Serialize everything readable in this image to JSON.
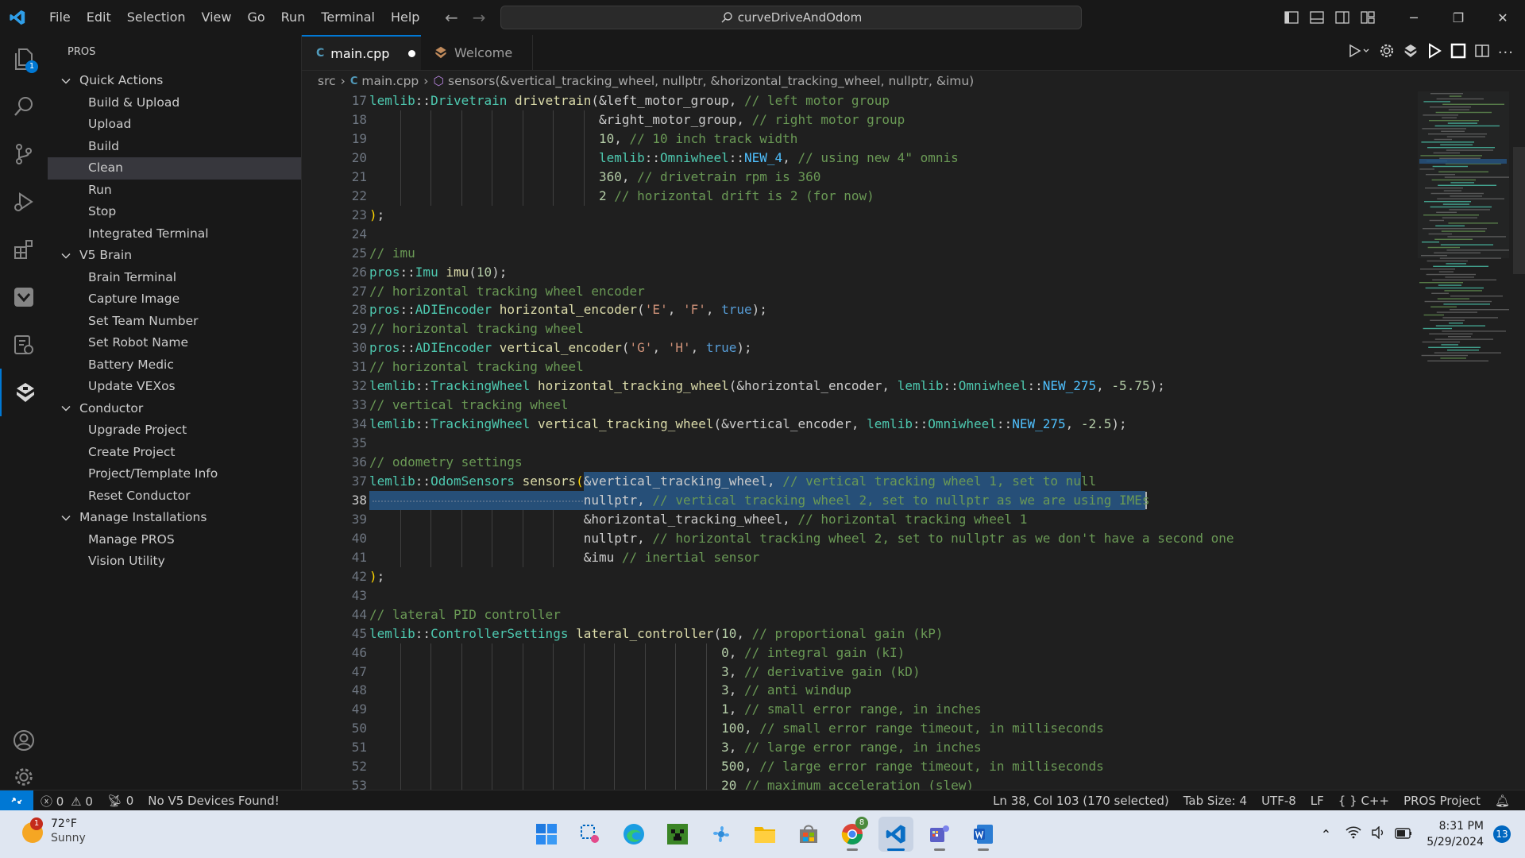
{
  "menu": [
    "File",
    "Edit",
    "Selection",
    "View",
    "Go",
    "Run",
    "Terminal",
    "Help"
  ],
  "command_center": "curveDriveAndOdom",
  "activity_bar": {
    "explorer_badge": "1",
    "items": [
      "files-icon",
      "search-icon",
      "source-control-icon",
      "run-debug-icon",
      "extensions-icon",
      "vex-icon",
      "remote-explorer-icon",
      "pros-icon"
    ],
    "bottom": [
      "accounts-icon",
      "settings-gear-icon"
    ]
  },
  "sidebar": {
    "title": "PROS",
    "groups": [
      {
        "label": "Quick Actions",
        "items": [
          "Build & Upload",
          "Upload",
          "Build",
          "Clean",
          "Run",
          "Stop",
          "Integrated Terminal"
        ]
      },
      {
        "label": "V5 Brain",
        "items": [
          "Brain Terminal",
          "Capture Image",
          "Set Team Number",
          "Set Robot Name",
          "Battery Medic",
          "Update VEXos"
        ]
      },
      {
        "label": "Conductor",
        "items": [
          "Upgrade Project",
          "Create Project",
          "Project/Template Info",
          "Reset Conductor"
        ]
      },
      {
        "label": "Manage Installations",
        "items": [
          "Manage PROS",
          "Vision Utility"
        ]
      }
    ],
    "selected": "Clean"
  },
  "tabs": [
    {
      "label": "main.cpp",
      "dirty": true,
      "active": true
    },
    {
      "label": "Welcome",
      "dirty": false,
      "active": false
    }
  ],
  "breadcrumb": {
    "folder": "src",
    "file": "main.cpp",
    "symbol": "sensors(&vertical_tracking_wheel, nullptr, &horizontal_tracking_wheel, nullptr, &imu)"
  },
  "editor": {
    "current_line": 38,
    "lines": [
      {
        "n": 17,
        "t": [
          [
            "ns",
            "lemlib"
          ],
          [
            "p",
            "::"
          ],
          [
            "ty",
            "Drivetrain"
          ],
          [
            "p",
            " "
          ],
          [
            "fn",
            "drivetrain"
          ],
          [
            "p",
            "("
          ],
          [
            "p",
            "&left_motor_group"
          ],
          [
            "p",
            ", "
          ],
          [
            "c",
            "// left motor group"
          ]
        ]
      },
      {
        "n": 18,
        "t": [
          [
            "p",
            "                              "
          ],
          [
            "p",
            "&right_motor_group"
          ],
          [
            "p",
            ", "
          ],
          [
            "c",
            "// right motor group"
          ]
        ]
      },
      {
        "n": 19,
        "t": [
          [
            "p",
            "                              "
          ],
          [
            "num",
            "10"
          ],
          [
            "p",
            ", "
          ],
          [
            "c",
            "// 10 inch track width"
          ]
        ]
      },
      {
        "n": 20,
        "t": [
          [
            "p",
            "                              "
          ],
          [
            "ns",
            "lemlib"
          ],
          [
            "p",
            "::"
          ],
          [
            "ty",
            "Omniwheel"
          ],
          [
            "p",
            "::"
          ],
          [
            "mac",
            "NEW_4"
          ],
          [
            "p",
            ", "
          ],
          [
            "c",
            "// using new 4\" omnis"
          ]
        ]
      },
      {
        "n": 21,
        "t": [
          [
            "p",
            "                              "
          ],
          [
            "num",
            "360"
          ],
          [
            "p",
            ", "
          ],
          [
            "c",
            "// drivetrain rpm is 360"
          ]
        ]
      },
      {
        "n": 22,
        "t": [
          [
            "p",
            "                              "
          ],
          [
            "num",
            "2"
          ],
          [
            "p",
            " "
          ],
          [
            "c",
            "// horizontal drift is 2 (for now)"
          ]
        ]
      },
      {
        "n": 23,
        "t": [
          [
            "br",
            ")"
          ],
          [
            "p",
            ";"
          ]
        ]
      },
      {
        "n": 24,
        "t": []
      },
      {
        "n": 25,
        "t": [
          [
            "c",
            "// imu"
          ]
        ]
      },
      {
        "n": 26,
        "t": [
          [
            "ns",
            "pros"
          ],
          [
            "p",
            "::"
          ],
          [
            "ty",
            "Imu"
          ],
          [
            "p",
            " "
          ],
          [
            "fn",
            "imu"
          ],
          [
            "p",
            "("
          ],
          [
            "num",
            "10"
          ],
          [
            "p",
            ");"
          ]
        ]
      },
      {
        "n": 27,
        "t": [
          [
            "c",
            "// horizontal tracking wheel encoder"
          ]
        ]
      },
      {
        "n": 28,
        "t": [
          [
            "ns",
            "pros"
          ],
          [
            "p",
            "::"
          ],
          [
            "ty",
            "ADIEncoder"
          ],
          [
            "p",
            " "
          ],
          [
            "fn",
            "horizontal_encoder"
          ],
          [
            "p",
            "("
          ],
          [
            "str",
            "'E'"
          ],
          [
            "p",
            ", "
          ],
          [
            "str",
            "'F'"
          ],
          [
            "p",
            ", "
          ],
          [
            "kw",
            "true"
          ],
          [
            "p",
            ");"
          ]
        ]
      },
      {
        "n": 29,
        "t": [
          [
            "c",
            "// horizontal tracking wheel"
          ]
        ]
      },
      {
        "n": 30,
        "t": [
          [
            "ns",
            "pros"
          ],
          [
            "p",
            "::"
          ],
          [
            "ty",
            "ADIEncoder"
          ],
          [
            "p",
            " "
          ],
          [
            "fn",
            "vertical_encoder"
          ],
          [
            "p",
            "("
          ],
          [
            "str",
            "'G'"
          ],
          [
            "p",
            ", "
          ],
          [
            "str",
            "'H'"
          ],
          [
            "p",
            ", "
          ],
          [
            "kw",
            "true"
          ],
          [
            "p",
            ");"
          ]
        ]
      },
      {
        "n": 31,
        "t": [
          [
            "c",
            "// horizontal tracking wheel"
          ]
        ]
      },
      {
        "n": 32,
        "t": [
          [
            "ns",
            "lemlib"
          ],
          [
            "p",
            "::"
          ],
          [
            "ty",
            "TrackingWheel"
          ],
          [
            "p",
            " "
          ],
          [
            "fn",
            "horizontal_tracking_wheel"
          ],
          [
            "p",
            "(&horizontal_encoder, "
          ],
          [
            "ns",
            "lemlib"
          ],
          [
            "p",
            "::"
          ],
          [
            "ty",
            "Omniwheel"
          ],
          [
            "p",
            "::"
          ],
          [
            "mac",
            "NEW_275"
          ],
          [
            "p",
            ", "
          ],
          [
            "num",
            "-5.75"
          ],
          [
            "p",
            ");"
          ]
        ]
      },
      {
        "n": 33,
        "t": [
          [
            "c",
            "// vertical tracking wheel"
          ]
        ]
      },
      {
        "n": 34,
        "t": [
          [
            "ns",
            "lemlib"
          ],
          [
            "p",
            "::"
          ],
          [
            "ty",
            "TrackingWheel"
          ],
          [
            "p",
            " "
          ],
          [
            "fn",
            "vertical_tracking_wheel"
          ],
          [
            "p",
            "(&vertical_encoder, "
          ],
          [
            "ns",
            "lemlib"
          ],
          [
            "p",
            "::"
          ],
          [
            "ty",
            "Omniwheel"
          ],
          [
            "p",
            "::"
          ],
          [
            "mac",
            "NEW_275"
          ],
          [
            "p",
            ", "
          ],
          [
            "num",
            "-2.5"
          ],
          [
            "p",
            ");"
          ]
        ]
      },
      {
        "n": 35,
        "t": []
      },
      {
        "n": 36,
        "t": [
          [
            "c",
            "// odometry settings"
          ]
        ]
      },
      {
        "n": 37,
        "t": [
          [
            "ns",
            "lemlib"
          ],
          [
            "p",
            "::"
          ],
          [
            "ty",
            "OdomSensors"
          ],
          [
            "p",
            " "
          ],
          [
            "fn",
            "sensors"
          ],
          [
            "br",
            "("
          ],
          [
            "p",
            "&vertical_tracking_wheel"
          ],
          [
            "p",
            ", "
          ],
          [
            "c",
            "// vertical tracking wheel 1, set to null"
          ]
        ]
      },
      {
        "n": 38,
        "t": [
          [
            "p",
            "                            "
          ],
          [
            "p",
            "nullptr"
          ],
          [
            "p",
            ", "
          ],
          [
            "c",
            "// vertical tracking wheel 2, set to nullptr as we are using IMEs"
          ]
        ]
      },
      {
        "n": 39,
        "t": [
          [
            "p",
            "                            "
          ],
          [
            "p",
            "&horizontal_tracking_wheel"
          ],
          [
            "p",
            ", "
          ],
          [
            "c",
            "// horizontal tracking wheel 1"
          ]
        ]
      },
      {
        "n": 40,
        "t": [
          [
            "p",
            "                            "
          ],
          [
            "p",
            "nullptr"
          ],
          [
            "p",
            ", "
          ],
          [
            "c",
            "// horizontal tracking wheel 2, set to nullptr as we don't have a second one"
          ]
        ]
      },
      {
        "n": 41,
        "t": [
          [
            "p",
            "                            "
          ],
          [
            "p",
            "&imu"
          ],
          [
            "p",
            " "
          ],
          [
            "c",
            "// inertial sensor"
          ]
        ]
      },
      {
        "n": 42,
        "t": [
          [
            "br",
            ")"
          ],
          [
            "p",
            ";"
          ]
        ]
      },
      {
        "n": 43,
        "t": []
      },
      {
        "n": 44,
        "t": [
          [
            "c",
            "// lateral PID controller"
          ]
        ]
      },
      {
        "n": 45,
        "t": [
          [
            "ns",
            "lemlib"
          ],
          [
            "p",
            "::"
          ],
          [
            "ty",
            "ControllerSettings"
          ],
          [
            "p",
            " "
          ],
          [
            "fn",
            "lateral_controller"
          ],
          [
            "p",
            "("
          ],
          [
            "num",
            "10"
          ],
          [
            "p",
            ", "
          ],
          [
            "c",
            "// proportional gain (kP)"
          ]
        ]
      },
      {
        "n": 46,
        "t": [
          [
            "p",
            "                                              "
          ],
          [
            "num",
            "0"
          ],
          [
            "p",
            ", "
          ],
          [
            "c",
            "// integral gain (kI)"
          ]
        ]
      },
      {
        "n": 47,
        "t": [
          [
            "p",
            "                                              "
          ],
          [
            "num",
            "3"
          ],
          [
            "p",
            ", "
          ],
          [
            "c",
            "// derivative gain (kD)"
          ]
        ]
      },
      {
        "n": 48,
        "t": [
          [
            "p",
            "                                              "
          ],
          [
            "num",
            "3"
          ],
          [
            "p",
            ", "
          ],
          [
            "c",
            "// anti windup"
          ]
        ]
      },
      {
        "n": 49,
        "t": [
          [
            "p",
            "                                              "
          ],
          [
            "num",
            "1"
          ],
          [
            "p",
            ", "
          ],
          [
            "c",
            "// small error range, in inches"
          ]
        ]
      },
      {
        "n": 50,
        "t": [
          [
            "p",
            "                                              "
          ],
          [
            "num",
            "100"
          ],
          [
            "p",
            ", "
          ],
          [
            "c",
            "// small error range timeout, in milliseconds"
          ]
        ]
      },
      {
        "n": 51,
        "t": [
          [
            "p",
            "                                              "
          ],
          [
            "num",
            "3"
          ],
          [
            "p",
            ", "
          ],
          [
            "c",
            "// large error range, in inches"
          ]
        ]
      },
      {
        "n": 52,
        "t": [
          [
            "p",
            "                                              "
          ],
          [
            "num",
            "500"
          ],
          [
            "p",
            ", "
          ],
          [
            "c",
            "// large error range timeout, in milliseconds"
          ]
        ]
      },
      {
        "n": 53,
        "t": [
          [
            "p",
            "                                              "
          ],
          [
            "num",
            "20"
          ],
          [
            "p",
            " "
          ],
          [
            "c",
            "// maximum acceleration (slew)"
          ]
        ]
      }
    ]
  },
  "status_bar": {
    "errors": "0",
    "warnings": "0",
    "ports": "0",
    "devices": "No V5 Devices Found!",
    "position": "Ln 38, Col 103 (170 selected)",
    "tab_size": "Tab Size: 4",
    "encoding": "UTF-8",
    "eol": "LF",
    "language": "C++",
    "project": "PROS Project"
  },
  "taskbar": {
    "weather_temp": "72°F",
    "weather_desc": "Sunny",
    "weather_badge": "1",
    "chrome_badge": "8",
    "time": "8:31 PM",
    "date": "5/29/2024",
    "notif_count": "13"
  },
  "colors": {
    "accent": "#0078d4",
    "selection": "#264f78",
    "comment": "#6a9955",
    "keyword": "#569cd6",
    "type": "#4ec9b0",
    "function": "#dcdcaa",
    "number": "#b5cea8",
    "string": "#ce9178",
    "macro": "#4fc1ff"
  }
}
